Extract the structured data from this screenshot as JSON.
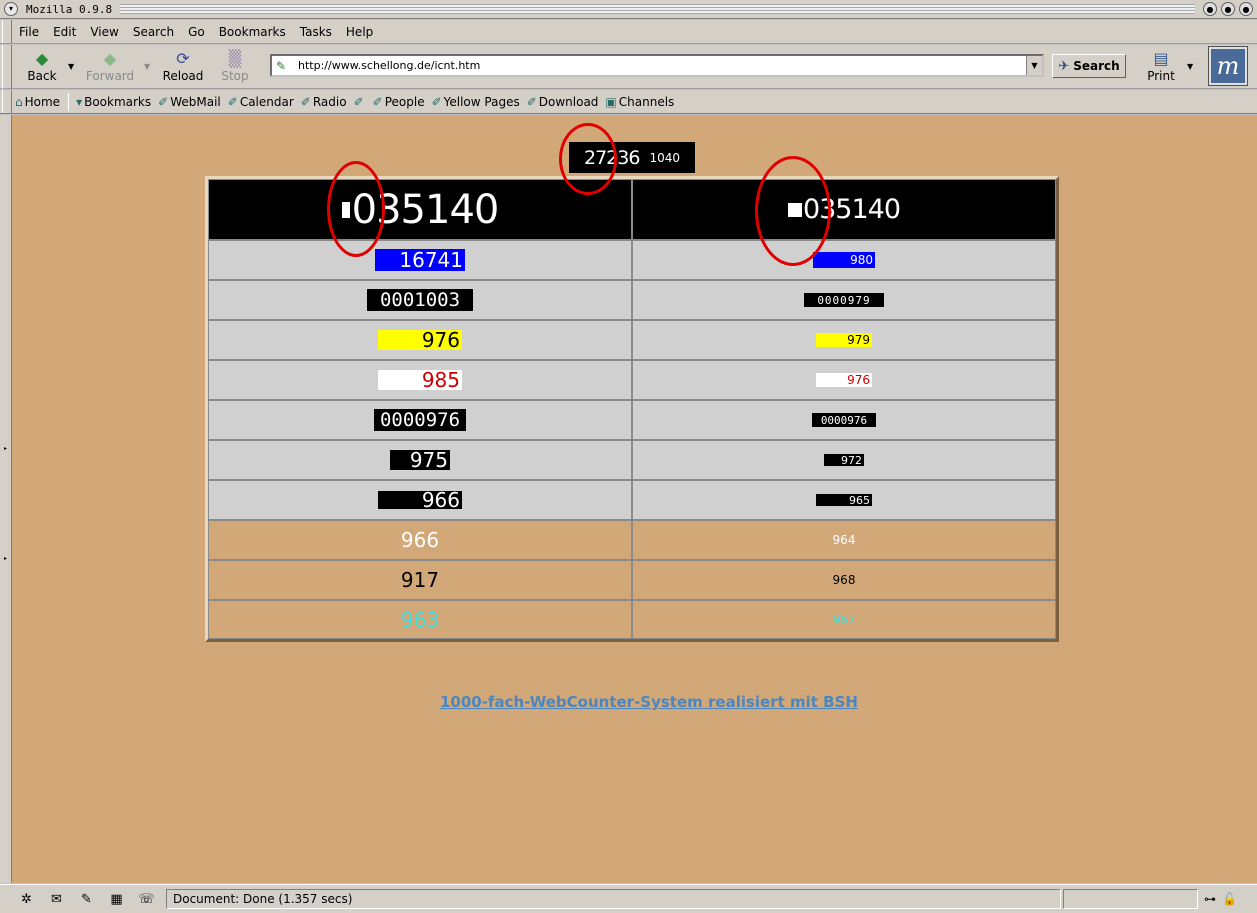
{
  "window": {
    "title": "Mozilla 0.9.8"
  },
  "menu": [
    "File",
    "Edit",
    "View",
    "Search",
    "Go",
    "Bookmarks",
    "Tasks",
    "Help"
  ],
  "nav": {
    "back": "Back",
    "forward": "Forward",
    "reload": "Reload",
    "stop": "Stop",
    "url": "http://www.schellong.de/icnt.htm",
    "search": "Search",
    "print": "Print"
  },
  "personal": [
    "Home",
    "Bookmarks",
    "WebMail",
    "Calendar",
    "Radio",
    "",
    "People",
    "Yellow Pages",
    "Download",
    "Channels"
  ],
  "page": {
    "top_counter": {
      "big": "27236",
      "small": "1040"
    },
    "head": {
      "left": "035140",
      "right": "035140"
    },
    "rows": [
      {
        "left": "16741",
        "right": "980",
        "style": "blue"
      },
      {
        "left": "0001003",
        "right": "0000979",
        "style": "black-mono"
      },
      {
        "left": "976",
        "right": "979",
        "style": "yellow"
      },
      {
        "left": "985",
        "right": "976",
        "style": "white-red"
      },
      {
        "left": "0000976",
        "right": "0000976",
        "style": "black-mono"
      },
      {
        "left": "975",
        "right": "972",
        "style": "black"
      },
      {
        "left": "966",
        "right": "965",
        "style": "black"
      },
      {
        "left": "966",
        "right": "964",
        "style": "tan-white"
      },
      {
        "left": "917",
        "right": "968",
        "style": "tan-black"
      },
      {
        "left": "963",
        "right": "967",
        "style": "tan-cyan"
      }
    ],
    "footer_link": "1000-fach-WebCounter-System realisiert mit BSH"
  },
  "status": {
    "text": "Document: Done (1.357 secs)"
  },
  "colors": {
    "content_bg": "#d2a878",
    "annotation": "#e00000",
    "link": "#4a86c0"
  }
}
